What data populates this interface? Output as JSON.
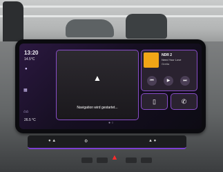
{
  "status": {
    "time": "13:20",
    "temperature": "14.5°C",
    "seat_temp": "26.5 °C"
  },
  "navigation": {
    "message": "Navigation wird gestartet..."
  },
  "media": {
    "station": "NDR 2",
    "song": "Need Your Love",
    "artist": "Gretta"
  },
  "icons": {
    "nav_arrow": "navigation-arrow-icon",
    "prev": "previous-icon",
    "play": "play-icon",
    "next": "next-icon",
    "phone": "phone-icon",
    "device": "device-icon",
    "hazard": "hazard-warning-icon"
  },
  "colors": {
    "accent": "#8a4ec9",
    "album": "#f2a516",
    "hazard": "#ff2b2b"
  }
}
